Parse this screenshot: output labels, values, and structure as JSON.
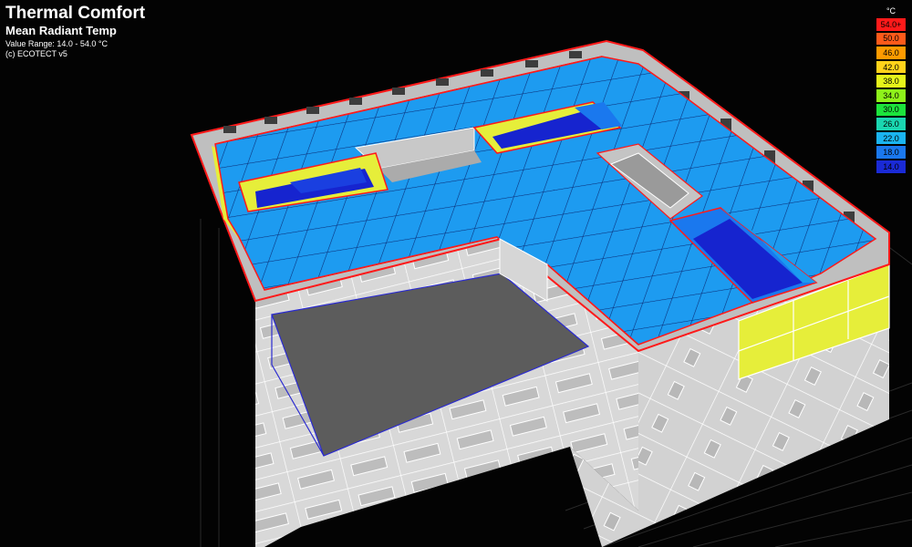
{
  "header": {
    "title": "Thermal Comfort",
    "subtitle": "Mean Radiant Temp",
    "range": "Value Range: 14.0 - 54.0 °C",
    "credit": "(c) ECOTECT v5"
  },
  "legend": {
    "unit": "°C",
    "items": [
      {
        "label": "54.0+",
        "color": "#ff1a1a"
      },
      {
        "label": "50.0",
        "color": "#ff5a1a"
      },
      {
        "label": "46.0",
        "color": "#ff9b00"
      },
      {
        "label": "42.0",
        "color": "#ffd21a"
      },
      {
        "label": "38.0",
        "color": "#e6f51a"
      },
      {
        "label": "34.0",
        "color": "#8ef21a"
      },
      {
        "label": "30.0",
        "color": "#1ce43c"
      },
      {
        "label": "26.0",
        "color": "#1ad6b0"
      },
      {
        "label": "22.0",
        "color": "#1ab4f0"
      },
      {
        "label": "18.0",
        "color": "#1a78ee"
      },
      {
        "label": "14.0",
        "color": "#1a2ad6"
      }
    ]
  },
  "colors": {
    "roof": "#1d9bf0",
    "cold": "#1624cf",
    "warm": "#e6ee3a",
    "wall": "#dcdcdc",
    "wall_dark": "#9a9a9a",
    "outline": "#ff1a1a"
  }
}
